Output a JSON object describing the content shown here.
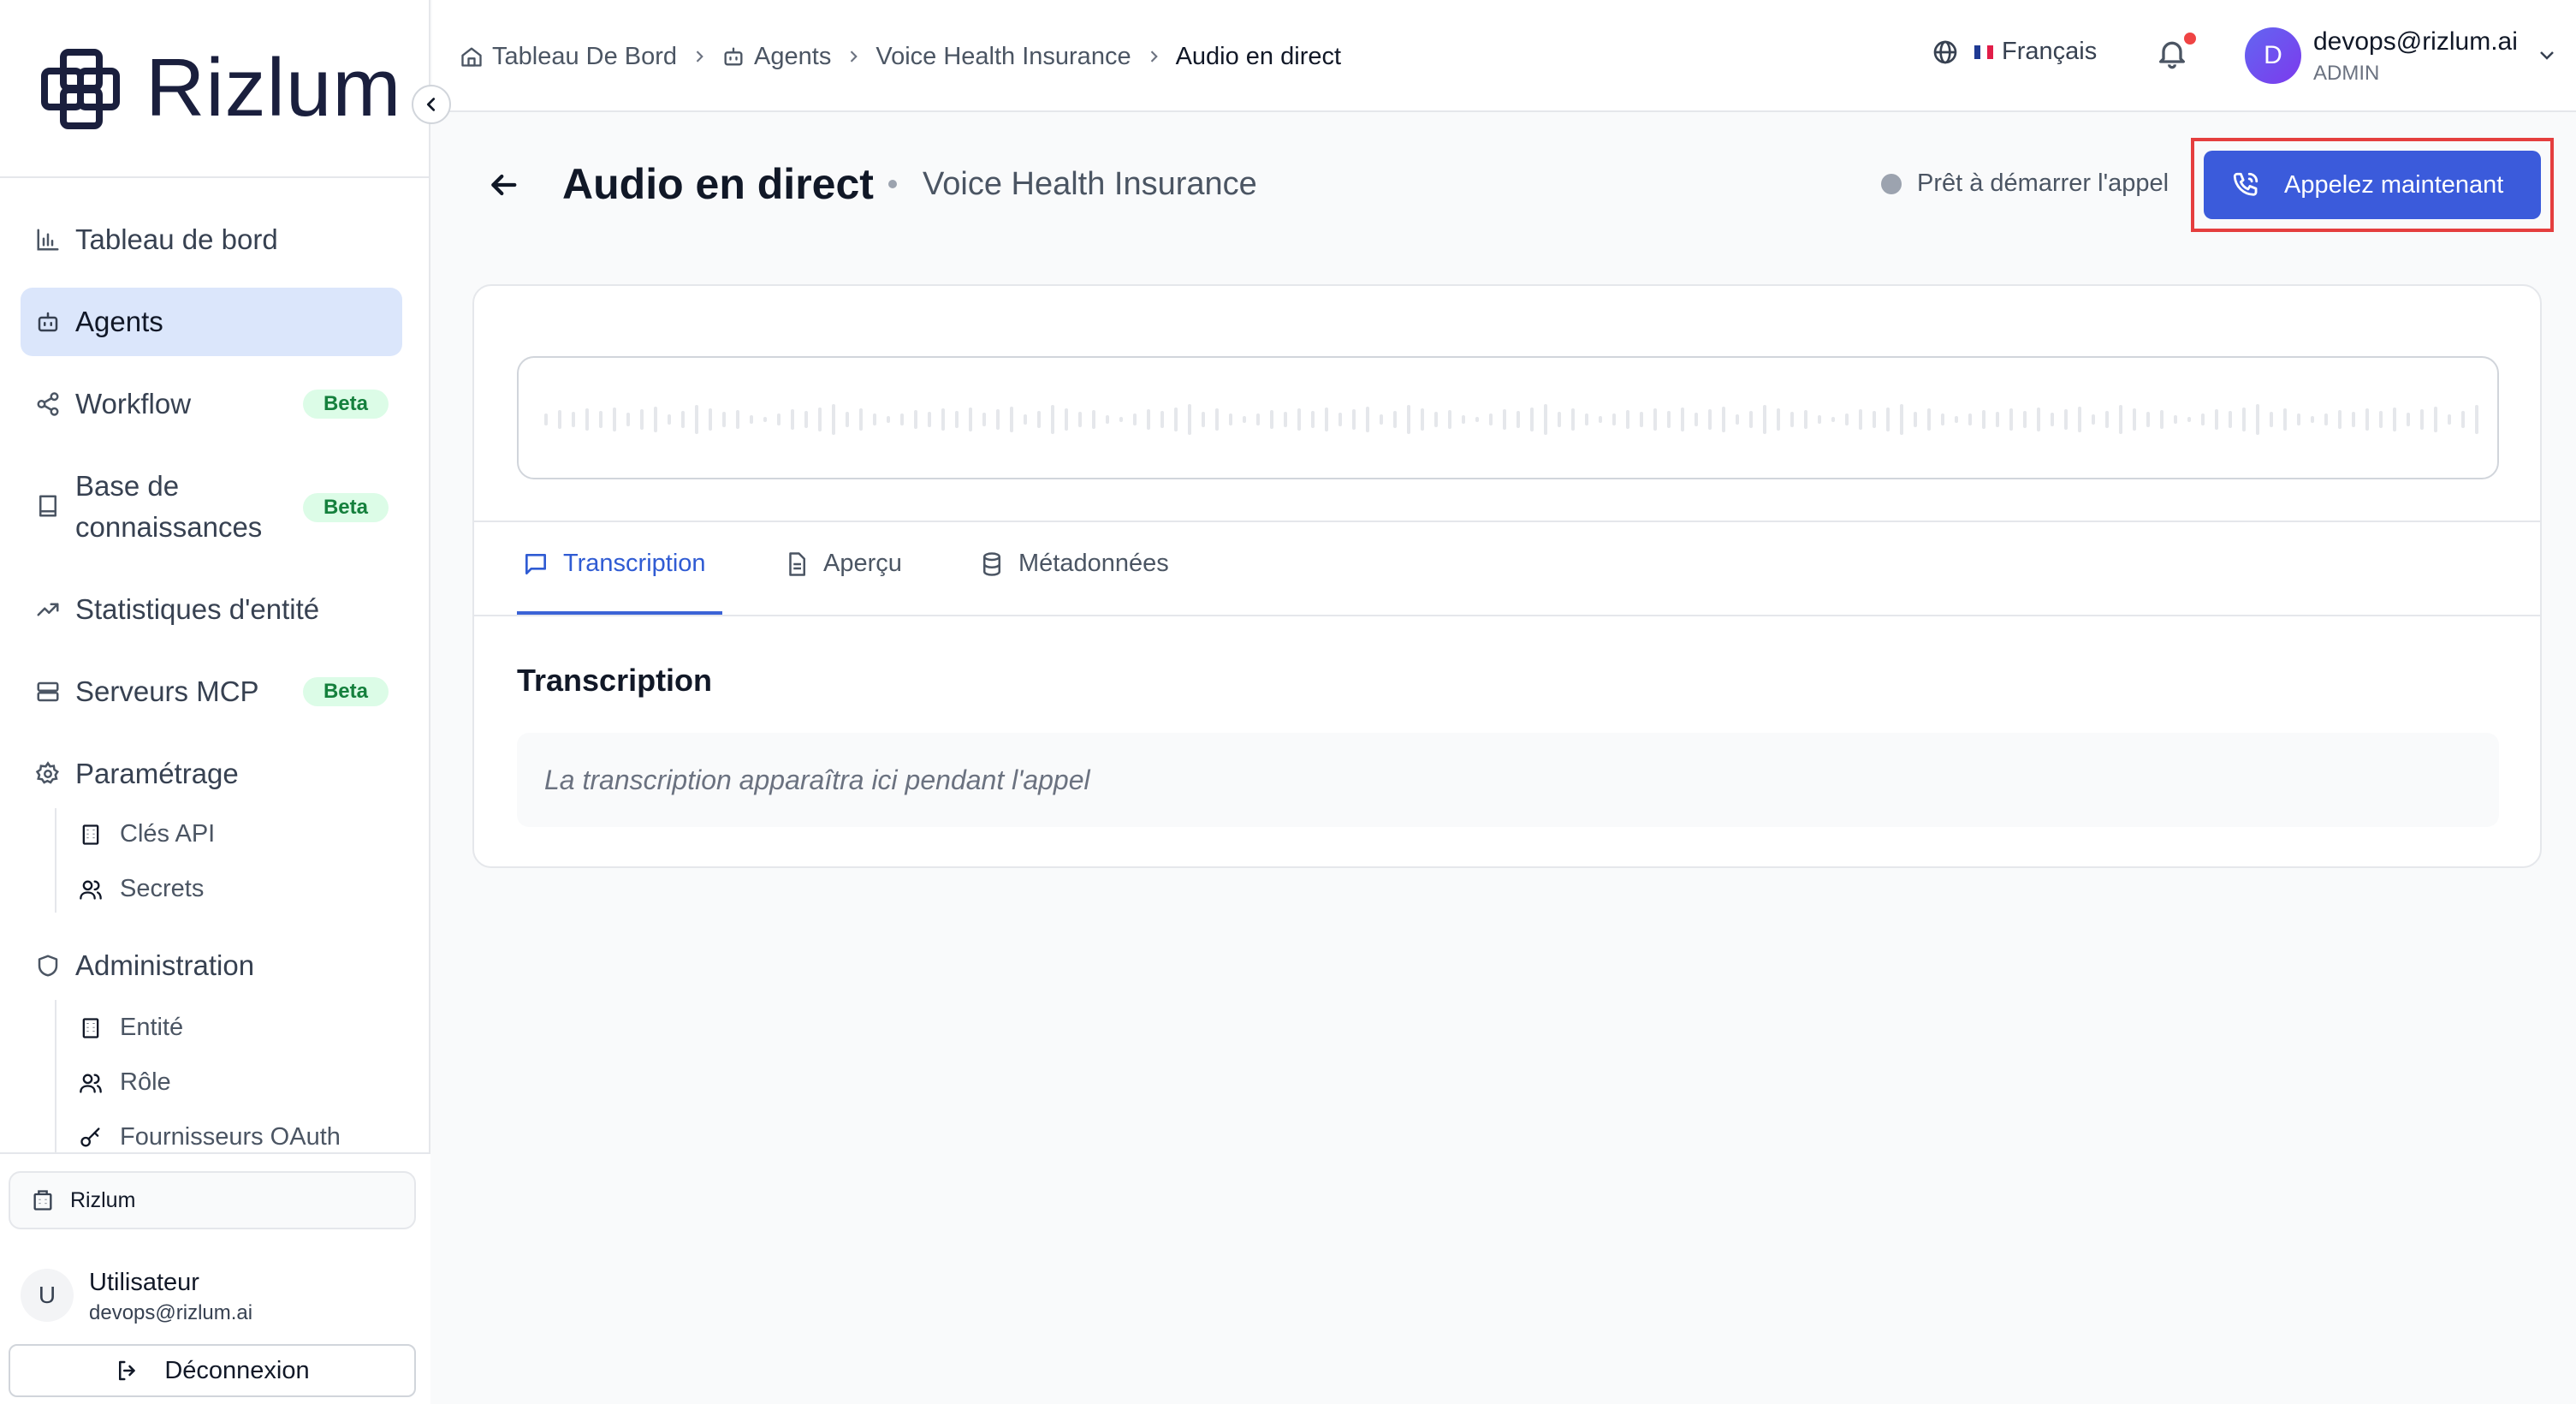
{
  "brand": {
    "name": "Rizlum",
    "color": "#1a1f3d"
  },
  "sidebar": {
    "nav": [
      {
        "label": "Tableau de bord",
        "icon": "bar-chart-icon"
      },
      {
        "label": "Agents",
        "icon": "bot-icon",
        "active": true
      },
      {
        "label": "Workflow",
        "icon": "share-nodes-icon",
        "badge": "Beta"
      },
      {
        "label": "Base de connaissances",
        "icon": "book-icon",
        "badge": "Beta"
      },
      {
        "label": "Statistiques d'entité",
        "icon": "trending-up-icon"
      },
      {
        "label": "Serveurs MCP",
        "icon": "server-icon",
        "badge": "Beta"
      },
      {
        "label": "Paramétrage",
        "icon": "gear-icon"
      },
      {
        "label": "Administration",
        "icon": "shield-icon"
      }
    ],
    "settings_children": [
      {
        "label": "Clés API",
        "icon": "building-icon"
      },
      {
        "label": "Secrets",
        "icon": "users-icon"
      }
    ],
    "admin_children": [
      {
        "label": "Entité",
        "icon": "building-icon"
      },
      {
        "label": "Rôle",
        "icon": "users-icon"
      },
      {
        "label": "Fournisseurs OAuth",
        "icon": "key-icon"
      }
    ],
    "organization": "Rizlum",
    "user": {
      "initial": "U",
      "name": "Utilisateur",
      "email": "devops@rizlum.ai"
    },
    "logout_label": "Déconnexion"
  },
  "topbar": {
    "breadcrumbs": [
      "Tableau De Bord",
      "Agents",
      "Voice Health Insurance",
      "Audio en direct"
    ],
    "language": "Français",
    "account": {
      "initial": "D",
      "email": "devops@rizlum.ai",
      "role": "ADMIN"
    }
  },
  "page": {
    "title": "Audio en direct",
    "subtitle": "Voice Health Insurance",
    "status": "Prêt à démarrer l'appel",
    "call_button": "Appelez maintenant"
  },
  "tabs": [
    {
      "label": "Transcription",
      "active": true,
      "icon": "chat-icon"
    },
    {
      "label": "Aperçu",
      "icon": "document-icon"
    },
    {
      "label": "Métadonnées",
      "icon": "database-icon"
    }
  ],
  "transcription": {
    "title": "Transcription",
    "placeholder": "La transcription apparaîtra ici pendant l'appel"
  },
  "colors": {
    "accent": "#3b5bdb",
    "active_nav": "#dbe6fb",
    "beta_bg": "#dcfce7",
    "beta_text": "#15803d",
    "highlight": "#e53e3e"
  }
}
